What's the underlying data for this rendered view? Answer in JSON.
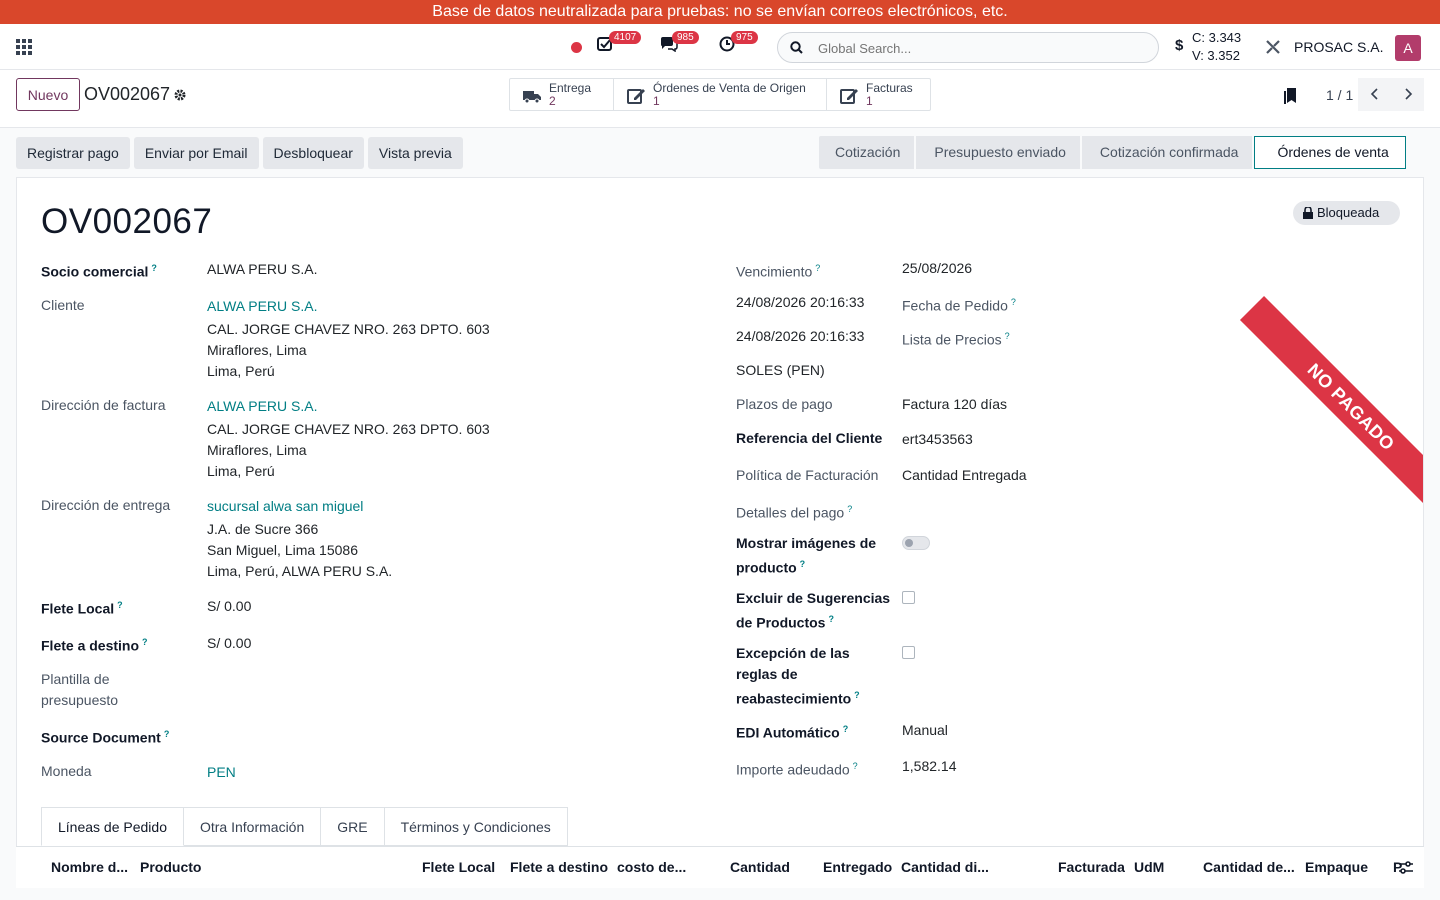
{
  "banner": {
    "text": "Base de datos neutralizada para pruebas: no se envían correos electrónicos, etc."
  },
  "navbar": {
    "badges": {
      "activities": "4107",
      "messages": "985",
      "clock": "975"
    },
    "search_placeholder": "Global Search...",
    "currency_symbol": "$",
    "rate_buy": "C: 3.343",
    "rate_sell": "V: 3.352",
    "company": "PROSAC S.A.",
    "avatar_letter": "A"
  },
  "control": {
    "new_label": "Nuevo",
    "record": "OV002067",
    "smart_buttons": [
      {
        "label": "Entrega",
        "value": "2",
        "icon": "truck-icon"
      },
      {
        "label": "Órdenes de Venta de Origen",
        "value": "1",
        "icon": "edit-icon"
      },
      {
        "label": "Facturas",
        "value": "1",
        "icon": "edit-icon"
      }
    ],
    "pager": "1 / 1"
  },
  "actions": [
    "Registrar pago",
    "Enviar por Email",
    "Desbloquear",
    "Vista previa"
  ],
  "statusbar": [
    "Cotización",
    "Presupuesto enviado",
    "Cotización confirmada",
    "Órdenes de venta"
  ],
  "statusbar_active": "Órdenes de venta",
  "sheet": {
    "ribbon": "NO PAGADO",
    "lock_label": "Bloqueada",
    "title": "OV002067",
    "left": {
      "socio_label": "Socio comercial",
      "socio_value": "ALWA PERU S.A.",
      "cliente_label": "Cliente",
      "cliente_name": "ALWA PERU S.A.",
      "cliente_addr1": "CAL. JORGE CHAVEZ NRO. 263 DPTO. 603",
      "cliente_addr2": "Miraflores, Lima",
      "cliente_addr3": "Lima, Perú",
      "factura_label": "Dirección de factura",
      "factura_name": "ALWA PERU S.A.",
      "factura_addr1": "CAL. JORGE CHAVEZ NRO. 263 DPTO. 603",
      "factura_addr2": "Miraflores, Lima",
      "factura_addr3": "Lima, Perú",
      "entrega_label": "Dirección de entrega",
      "entrega_name": "sucursal alwa san miguel",
      "entrega_addr1": "J.A. de Sucre 366",
      "entrega_addr2": "San Miguel, Lima 15086",
      "entrega_addr3": "Lima, Perú, ALWA PERU S.A.",
      "flete_local_label": "Flete Local",
      "flete_local_value": "S/ 0.00",
      "flete_destino_label": "Flete a destino",
      "flete_destino_value": "S/ 0.00",
      "plantilla_label1": "Plantilla de",
      "plantilla_label2": "presupuesto",
      "source_label": "Source Document",
      "moneda_label": "Moneda",
      "moneda_value": "PEN"
    },
    "right": {
      "vencimiento_label": "Vencimiento",
      "vencimiento_value": "25/08/2026",
      "fecha_value": "24/08/2026 20:16:33",
      "fecha_label": "Fecha de Pedido",
      "lista_value": "24/08/2026 20:16:33",
      "lista_label": "Lista de Precios",
      "soles_value": "SOLES (PEN)",
      "plazos_label": "Plazos de pago",
      "plazos_value": "Factura 120 días",
      "referencia_label": "Referencia del Cliente",
      "referencia_value": "ert3453563",
      "politica_label": "Política de Facturación",
      "politica_value": "Cantidad Entregada",
      "detalles_label": "Detalles del pago",
      "mostrar_label1": "Mostrar imágenes de",
      "mostrar_label2": "producto",
      "excluir_label1": "Excluir de Sugerencias",
      "excluir_label2": "de Productos",
      "excepcion_label1": "Excepción de las",
      "excepcion_label2": "reglas de",
      "excepcion_label3": "reabastecimiento",
      "edi_label": "EDI Automático",
      "edi_value": "Manual",
      "importe_label": "Importe adeudado",
      "importe_value": "1,582.14"
    },
    "tabs": [
      "Líneas de Pedido",
      "Otra Información",
      "GRE",
      "Términos y Condiciones"
    ],
    "columns": [
      "Nombre d...",
      "Producto",
      "Flete Local",
      "Flete a destino",
      "costo de...",
      "Cantidad",
      "Entregado",
      "Cantidad di...",
      "Facturada",
      "UdM",
      "Cantidad de...",
      "Empaque",
      "P"
    ]
  }
}
